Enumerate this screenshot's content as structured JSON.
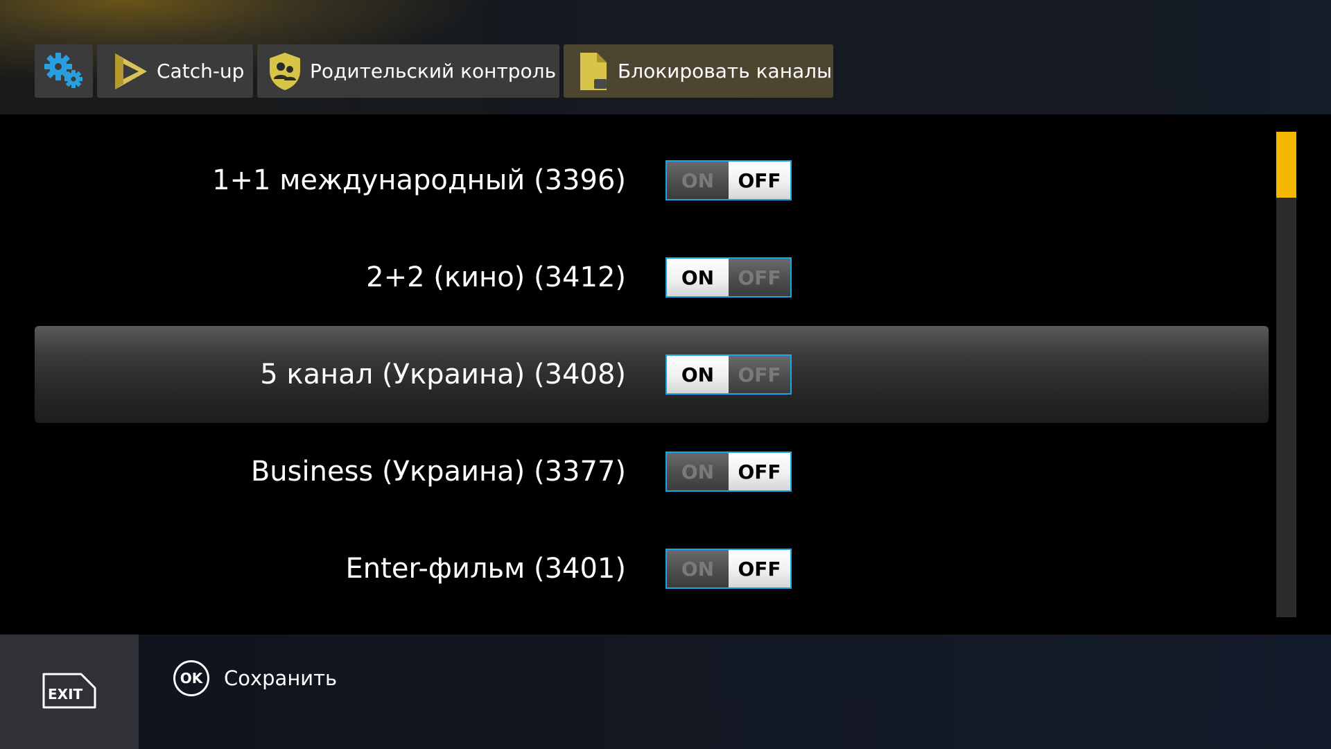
{
  "header": {
    "breadcrumbs": [
      {
        "icon": "gears-icon"
      },
      {
        "icon": "catchup-play-icon",
        "label": "Catch-up"
      },
      {
        "icon": "parental-shield-icon",
        "label": "Родительский контроль"
      },
      {
        "icon": "locked-document-icon",
        "label": "Блокировать каналы"
      }
    ]
  },
  "channels": [
    {
      "name": "1+1 международный (3396)",
      "state": "OFF"
    },
    {
      "name": "2+2 (кино) (3412)",
      "state": "ON"
    },
    {
      "name": "5 канал (Украина) (3408)",
      "state": "ON",
      "selected": true
    },
    {
      "name": "Business (Украина) (3377)",
      "state": "OFF"
    },
    {
      "name": "Enter-фильм (3401)",
      "state": "OFF"
    }
  ],
  "toggle": {
    "on_label": "ON",
    "off_label": "OFF"
  },
  "footer": {
    "exit_label": "EXIT",
    "ok_label": "OK",
    "save_label": "Сохранить"
  },
  "colors": {
    "accent": "#f5b800",
    "toggle_border": "#1aa6e8",
    "gear": "#2a9fe0"
  }
}
